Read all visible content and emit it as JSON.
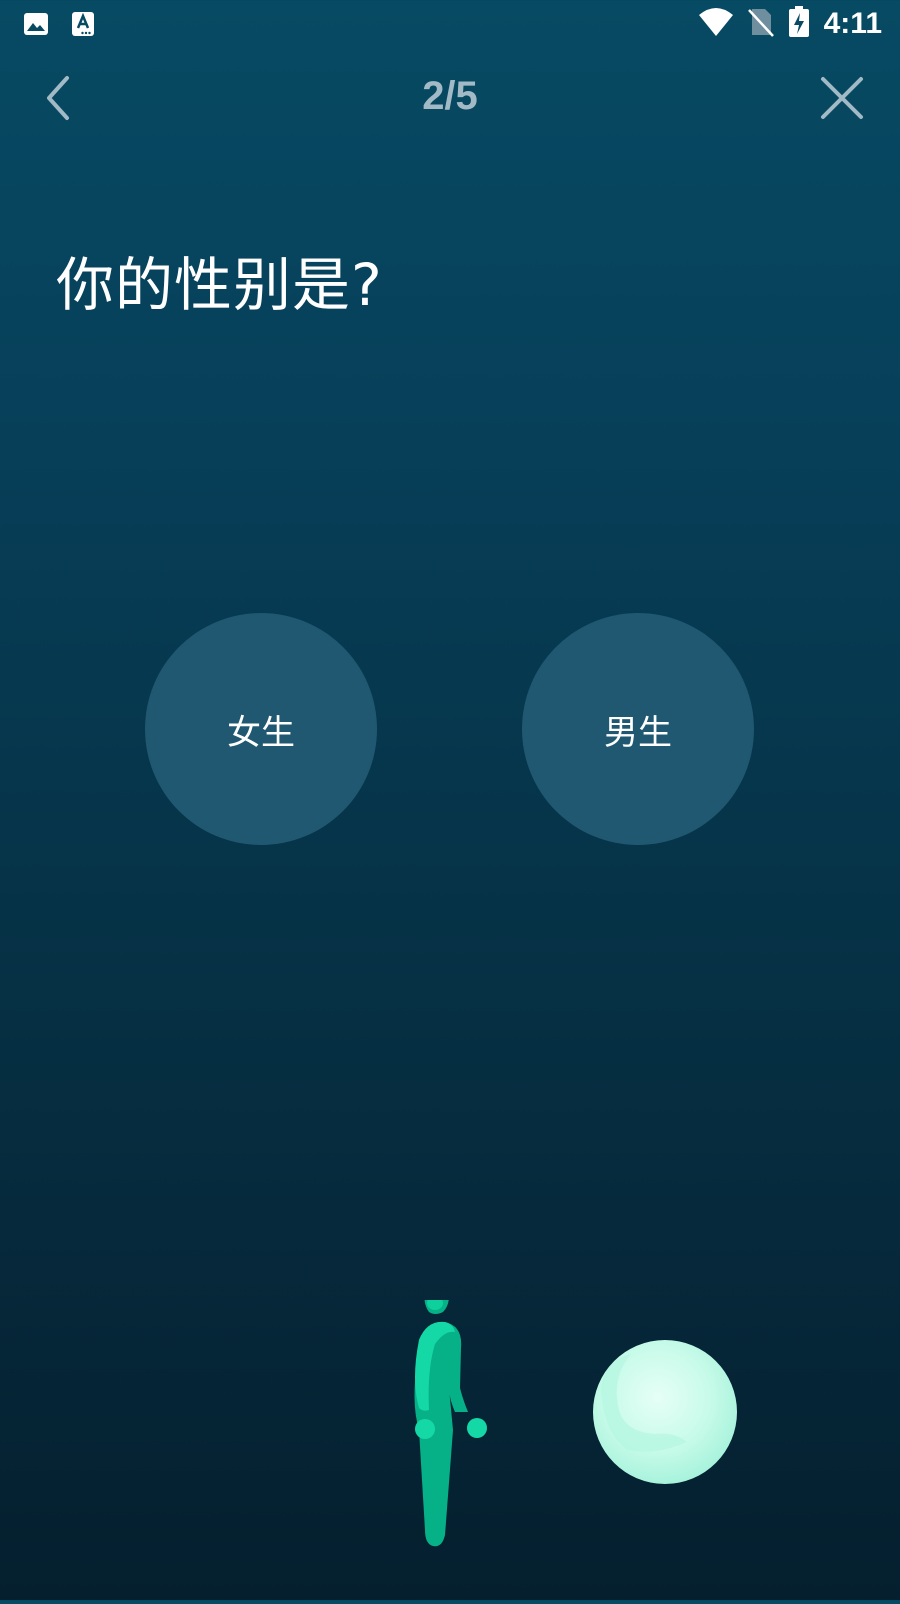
{
  "status_bar": {
    "time": "4:11",
    "left_icons": [
      "image-icon",
      "text-input-icon"
    ],
    "right_icons": [
      "wifi-icon",
      "no-sim-icon",
      "battery-charging-icon"
    ]
  },
  "nav": {
    "progress": "2/5",
    "back_icon": "chevron-left-icon",
    "close_icon": "close-icon"
  },
  "question": {
    "text": "你的性别是?"
  },
  "options": [
    {
      "label": "女生"
    },
    {
      "label": "男生"
    }
  ],
  "colors": {
    "background_top": "#074a63",
    "background_bottom": "#051f2e",
    "option_circle": "#1f5870",
    "progress_text": "#a2b9c6",
    "figure_green": "#07b188",
    "orb": "#c8fbe9"
  }
}
